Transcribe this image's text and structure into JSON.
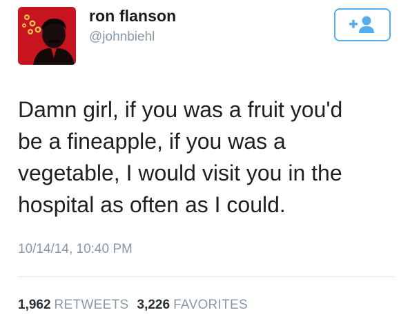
{
  "user": {
    "display_name": "ron flanson",
    "handle": "@johnbiehl"
  },
  "tweet": {
    "lines": [
      "Damn girl, if you was a fruit you'd",
      "be a fineapple, if you was a",
      "vegetable, I would visit you in the",
      "hospital as often as I could."
    ],
    "timestamp": "10/14/14, 10:40 PM"
  },
  "stats": {
    "retweets_count": "1,962",
    "retweets_label": "RETWEETS",
    "favorites_count": "3,226",
    "favorites_label": "FAVORITES"
  },
  "follow_button": {
    "icon": "add-user-icon"
  },
  "colors": {
    "accent": "#55acee",
    "avatar_bg": "#c8141e",
    "muted": "#8899a6"
  }
}
